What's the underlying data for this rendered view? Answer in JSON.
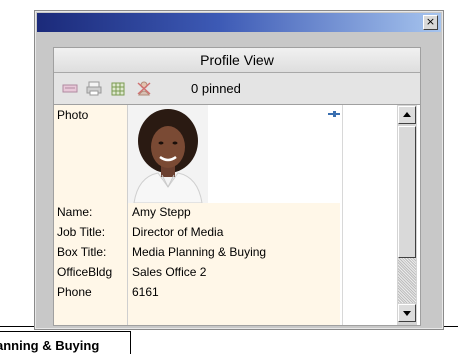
{
  "window": {
    "close_glyph": "×"
  },
  "panel": {
    "title": "Profile View",
    "pinned_text": "0 pinned",
    "toolbar_icons": [
      "card-icon",
      "print-icon",
      "grid-add-icon",
      "people-remove-icon"
    ]
  },
  "profile": {
    "photo_label": "Photo",
    "fields": [
      {
        "label": "Name:",
        "value": "Amy Stepp"
      },
      {
        "label": "Job Title:",
        "value": "Director of Media"
      },
      {
        "label": "Box Title:",
        "value": "Media Planning & Buying"
      },
      {
        "label": "OfficeBldg",
        "value": "Sales Office 2"
      },
      {
        "label": "Phone",
        "value": "6161"
      }
    ]
  },
  "background": {
    "box_text": "anning & Buying"
  },
  "colors": {
    "field_bg": "#fff7e8",
    "title_gradient_start": "#1b2a7a",
    "title_gradient_end": "#a6c4ee"
  }
}
